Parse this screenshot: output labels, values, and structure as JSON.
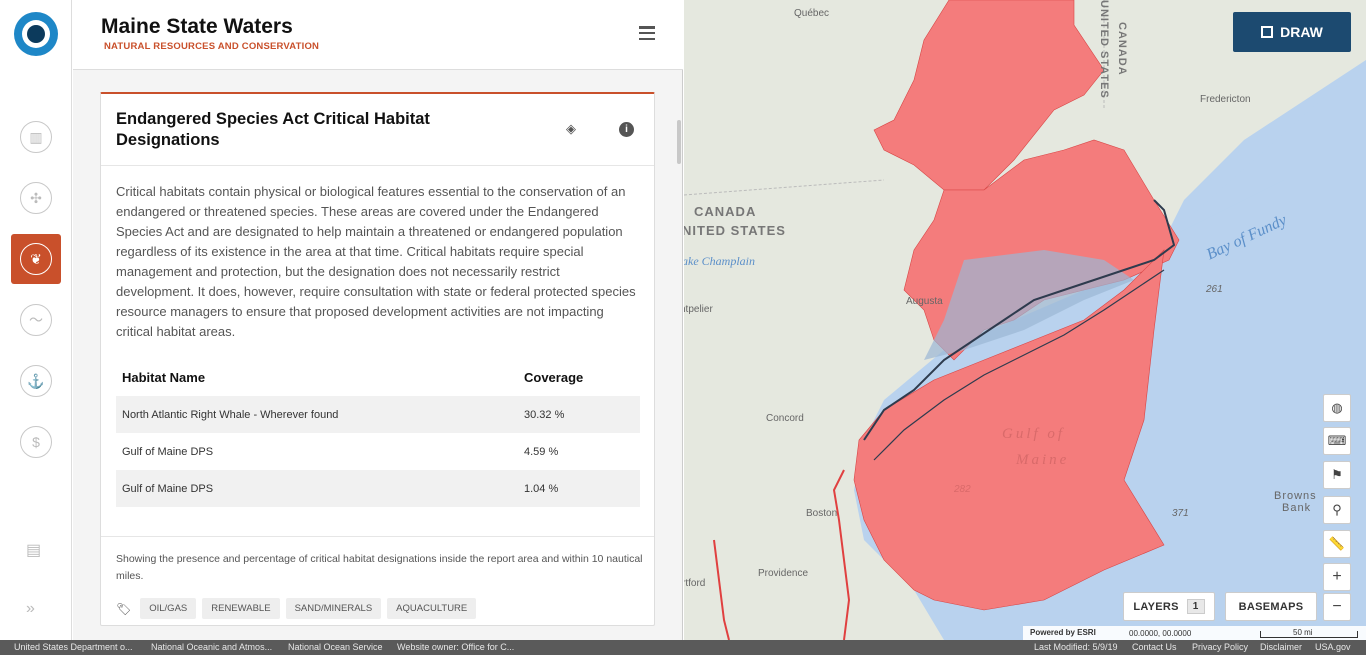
{
  "header": {
    "title": "Maine State Waters",
    "subtitle": "NATURAL RESOURCES AND CONSERVATION"
  },
  "rail": {
    "items": [
      {
        "icon": "bar-chart-icon"
      },
      {
        "icon": "wind-turbine-icon"
      },
      {
        "icon": "coral-icon",
        "active": true
      },
      {
        "icon": "wave-icon"
      },
      {
        "icon": "ship-icon"
      },
      {
        "icon": "money-icon"
      }
    ]
  },
  "card": {
    "title": "Endangered Species Act Critical Habitat Designations",
    "description": "Critical habitats contain physical or biological features essential to the conservation of an endangered or threatened species. These areas are covered under the Endangered Species Act and are designated to help maintain a threatened or endangered population regardless of its existence in the area at that time. Critical habitats require special management and protection, but the designation does not necessarily restrict development. It does, however, require consultation with state or federal protected species resource managers to ensure that proposed development activities are not impacting critical habitat areas.",
    "table": {
      "headers": [
        "Habitat Name",
        "Coverage"
      ],
      "rows": [
        [
          "North Atlantic Right Whale - Wherever found",
          "30.32 %"
        ],
        [
          "Gulf of Maine DPS",
          "4.59 %"
        ],
        [
          "Gulf of Maine DPS",
          "1.04 %"
        ]
      ]
    },
    "footer_text": "Showing the presence and percentage of critical habitat designations inside the report area and within 10 nautical miles.",
    "tags": [
      "OIL/GAS",
      "RENEWABLE",
      "SAND/MINERALS",
      "AQUACULTURE"
    ]
  },
  "map": {
    "draw_label": "DRAW",
    "layers_label": "LAYERS",
    "layers_count": "1",
    "basemaps_label": "BASEMAPS",
    "attribution": "Powered by ESRI",
    "coords": "00.0000, 00.0000",
    "scale": "50 mi",
    "labels": {
      "quebec": "Québec",
      "canada_v": "CANADA",
      "united_states_v": "UNITED STATES",
      "fredericton": "Fredericton",
      "canada": "CANADA",
      "united_states": "NITED STATES",
      "lake_champlain": "ake Champlain",
      "augusta": "Augusta",
      "montpelier": "ntpelier",
      "concord": "Concord",
      "boston": "Boston",
      "providence": "Providence",
      "hartford": "rtford",
      "bay_of_fundy": "Bay of Fundy",
      "gulf_of_maine_1": "Gulf of",
      "gulf_of_maine_2": "Maine",
      "browns_bank_1": "Browns",
      "browns_bank_2": "Bank",
      "d261": "261",
      "d371": "371",
      "d282": "282"
    },
    "colors": {
      "habitat": "#f47c7c",
      "water": "#b9d2ee",
      "land": "#e5e8df"
    }
  },
  "footer": {
    "links": [
      "United States Department o...",
      "National Oceanic and Atmos...",
      "National Ocean Service",
      "Website owner: Office for C..."
    ],
    "last_modified": "Last Modified: 5/9/19",
    "contact": "Contact Us",
    "privacy": "Privacy Policy",
    "disclaimer": "Disclaimer",
    "usagov": "USA.gov"
  }
}
